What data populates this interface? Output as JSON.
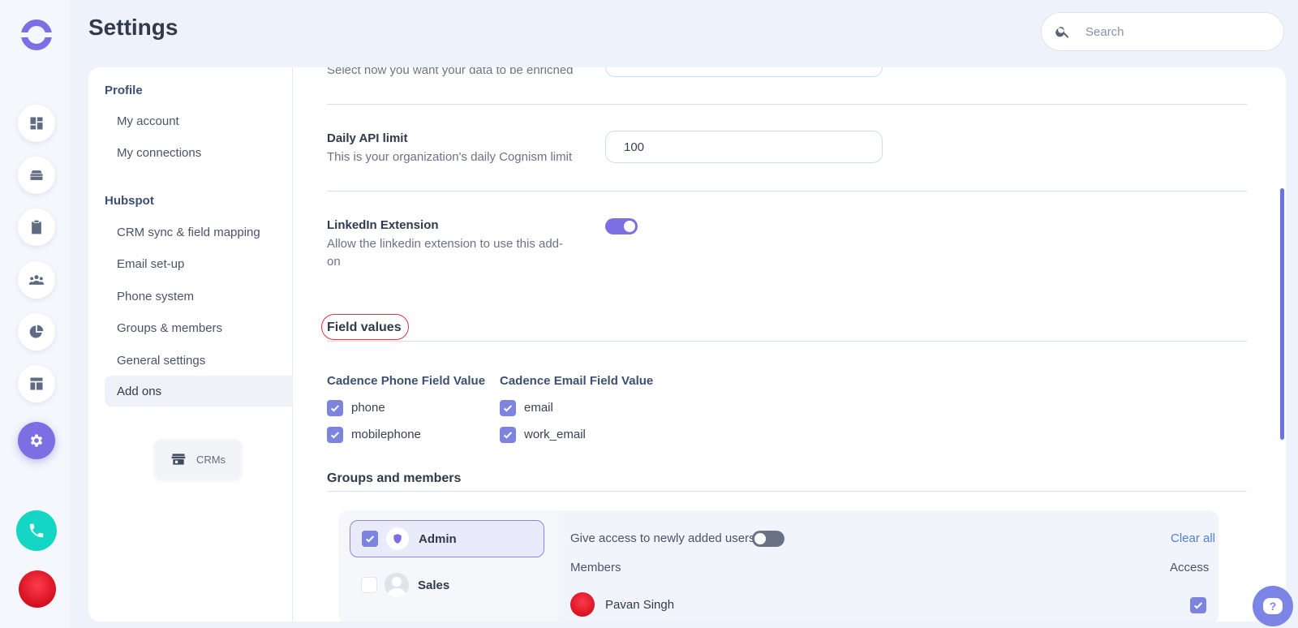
{
  "app": {
    "title": "Settings",
    "search_placeholder": "Search"
  },
  "rail": {
    "items": [
      {
        "icon": "dashboard-icon"
      },
      {
        "icon": "inbox-icon"
      },
      {
        "icon": "clipboard-icon"
      },
      {
        "icon": "team-icon"
      },
      {
        "icon": "pie-chart-icon"
      },
      {
        "icon": "layout-icon"
      },
      {
        "icon": "gear-icon",
        "active": true
      }
    ],
    "phone_icon": "phone-icon"
  },
  "subnav": {
    "sections": [
      {
        "heading": "Profile",
        "items": [
          "My account",
          "My connections"
        ]
      },
      {
        "heading": "Hubspot",
        "items": [
          "CRM sync & field mapping",
          "Email set-up",
          "Phone system",
          "Groups & members",
          "General settings",
          "Add ons"
        ]
      }
    ],
    "active_item": "Add ons",
    "crm_button": "CRMs"
  },
  "content": {
    "enrich": {
      "description": "Select how you want your data to be enriched"
    },
    "daily_api": {
      "label": "Daily API limit",
      "description": "This is your organization's daily Cognism limit",
      "value": "100"
    },
    "linkedin": {
      "label": "LinkedIn Extension",
      "description_line1": "Allow the linkedin extension to use this add-",
      "description_line2": "on",
      "enabled": true
    },
    "field_values": {
      "title": "Field values",
      "phone_column": {
        "heading": "Cadence Phone Field Value",
        "options": [
          {
            "label": "phone",
            "checked": true
          },
          {
            "label": "mobilephone",
            "checked": true
          }
        ]
      },
      "email_column": {
        "heading": "Cadence Email Field Value",
        "options": [
          {
            "label": "email",
            "checked": true
          },
          {
            "label": "work_email",
            "checked": true
          }
        ]
      }
    },
    "groups_members": {
      "title": "Groups and members",
      "groups": [
        {
          "name": "Admin",
          "checked": true,
          "icon": "shield-icon"
        },
        {
          "name": "Sales",
          "checked": false,
          "icon": "user-icon"
        }
      ],
      "new_users_label": "Give access to newly added users",
      "new_users_toggle": false,
      "clear_all": "Clear all",
      "members_header": "Members",
      "access_header": "Access",
      "members": [
        {
          "name": "Pavan Singh",
          "access": true
        }
      ]
    }
  },
  "colors": {
    "accent": "#7c6fe3",
    "phone": "#13d6c4",
    "link": "#4f7fe0",
    "highlight": "#e0323e"
  }
}
